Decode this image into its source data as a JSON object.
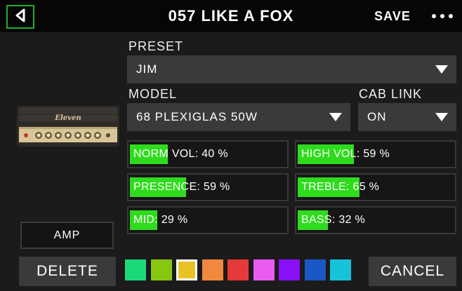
{
  "header": {
    "title": "057 LIKE A FOX",
    "save_label": "SAVE",
    "back_icon": "back-triangle-icon",
    "more_icon": "more-dots-icon"
  },
  "preset": {
    "label": "PRESET",
    "value": "JIM"
  },
  "model": {
    "label": "MODEL",
    "value": "68 PLEXIGLAS 50W"
  },
  "cab_link": {
    "label": "CAB LINK",
    "value": "ON"
  },
  "amp_image": {
    "brand_text": "Eleven"
  },
  "params": [
    {
      "text": "NORM VOL: 40 %",
      "value": 40
    },
    {
      "text": "HIGH VOL: 59 %",
      "value": 59
    },
    {
      "text": "PRESENCE: 59 %",
      "value": 59
    },
    {
      "text": "TREBLE: 65 %",
      "value": 65
    },
    {
      "text": "MID: 29 %",
      "value": 29
    },
    {
      "text": "BASS: 32 %",
      "value": 32
    }
  ],
  "amp_button_label": "AMP",
  "delete_label": "DELETE",
  "cancel_label": "CANCEL",
  "colors": {
    "accent": "#2fdc1d",
    "back_border": "#1fae2d",
    "swatches": [
      "#1ad97a",
      "#86c70f",
      "#e9c226",
      "#f2873e",
      "#e5393b",
      "#ea5cf0",
      "#8a10f5",
      "#1957c6",
      "#17c3d9"
    ],
    "selected_swatch_index": 2
  }
}
